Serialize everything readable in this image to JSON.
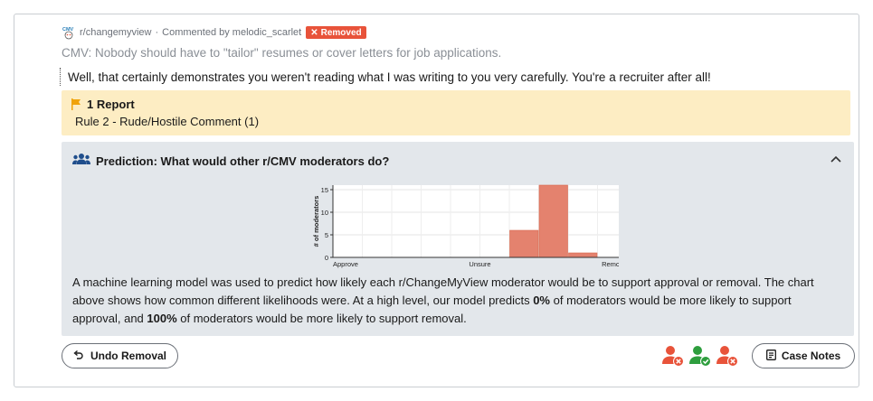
{
  "meta": {
    "subreddit": "r/changemyview",
    "separator": "·",
    "commented_by": "Commented by melodic_scarlet",
    "removed_label": "Removed"
  },
  "post_title": "CMV: Nobody should have to \"tailor\" resumes or cover letters for job applications.",
  "comment_text": "Well, that certainly demonstrates you weren't reading what I was writing to you very carefully. You're a recruiter after all!",
  "report": {
    "title": "1 Report",
    "rule": "Rule 2 - Rude/Hostile Comment (1)"
  },
  "prediction": {
    "title": "Prediction: What would other r/CMV moderators do?",
    "desc_part1": "A machine learning model was used to predict how likely each r/ChangeMyView moderator would be to support approval or removal. The chart above shows how common different likelihoods were. At a high level, our model predicts ",
    "approve_pct": "0%",
    "desc_part2": " of moderators would be more likely to support approval, and ",
    "remove_pct": "100%",
    "desc_part3": " of moderators would be more likely to support removal."
  },
  "chart_data": {
    "type": "bar",
    "ylabel": "# of moderators",
    "x_tick_labels": [
      "Approve",
      "Unsure",
      "Remove"
    ],
    "y_ticks": [
      0,
      5,
      10,
      15
    ],
    "ylim": [
      0,
      16
    ],
    "bins": [
      {
        "range": [
          0.0,
          0.1
        ],
        "value": 0
      },
      {
        "range": [
          0.1,
          0.2
        ],
        "value": 0
      },
      {
        "range": [
          0.2,
          0.3
        ],
        "value": 0
      },
      {
        "range": [
          0.3,
          0.4
        ],
        "value": 0
      },
      {
        "range": [
          0.4,
          0.5
        ],
        "value": 0
      },
      {
        "range": [
          0.5,
          0.6
        ],
        "value": 0
      },
      {
        "range": [
          0.6,
          0.7
        ],
        "value": 6
      },
      {
        "range": [
          0.7,
          0.8
        ],
        "value": 16
      },
      {
        "range": [
          0.8,
          0.9
        ],
        "value": 1
      },
      {
        "range": [
          0.9,
          1.0
        ],
        "value": 0
      }
    ],
    "bar_color": "#e4826e",
    "grid": true
  },
  "actions": {
    "undo_label": "Undo Removal",
    "case_notes_label": "Case Notes"
  },
  "colors": {
    "remove": "#e8533a",
    "approve": "#2e9e3e",
    "report_bg": "#fdedc3",
    "prediction_bg": "#e3e7eb"
  }
}
